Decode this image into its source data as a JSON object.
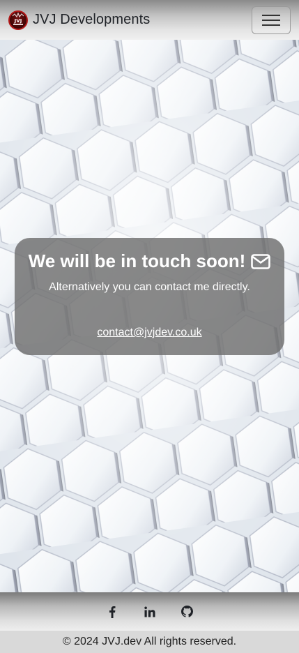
{
  "navbar": {
    "brand_name": "JVJ Developments",
    "logo_text": "JVJ",
    "toggler_icon": "hamburger-menu-icon"
  },
  "hero": {
    "title": "We will be in touch soon!",
    "title_icon": "envelope-icon",
    "subtitle": "Alternatively you can contact me directly.",
    "email": "contact@jvjdev.co.uk"
  },
  "footer": {
    "social": [
      {
        "name": "facebook",
        "icon": "facebook-icon"
      },
      {
        "name": "linkedin",
        "icon": "linkedin-icon"
      },
      {
        "name": "github",
        "icon": "github-icon"
      }
    ],
    "copyright": "© 2024 JVJ.dev All rights reserved."
  },
  "colors": {
    "card_bg": "#6e6e6e",
    "logo_red": "#b31818",
    "text_dark": "#1f2227"
  }
}
